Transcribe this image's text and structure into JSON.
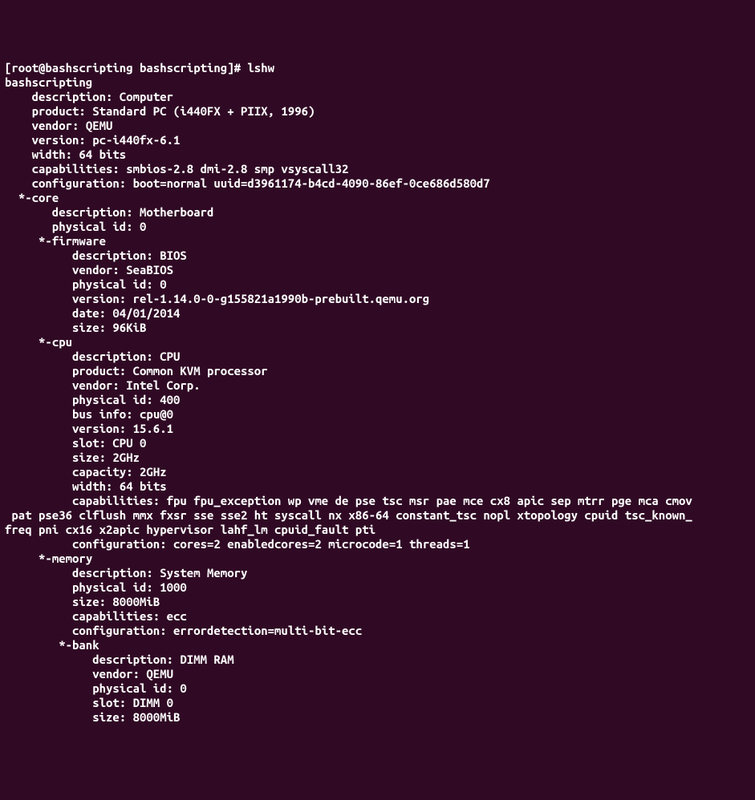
{
  "prompt": "[root@bashscripting bashscripting]# ",
  "command": "lshw",
  "hostname": "bashscripting",
  "root": {
    "description": "Computer",
    "product": "Standard PC (i440FX + PIIX, 1996)",
    "vendor": "QEMU",
    "version": "pc-i440fx-6.1",
    "width": "64 bits",
    "capabilities": "smbios-2.8 dmi-2.8 smp vsyscall32",
    "configuration": "boot=normal uuid=d3961174-b4cd-4090-86ef-0ce686d580d7"
  },
  "core": {
    "header": "*-core",
    "description": "Motherboard",
    "physical_id": "0"
  },
  "firmware": {
    "header": "*-firmware",
    "description": "BIOS",
    "vendor": "SeaBIOS",
    "physical_id": "0",
    "version": "rel-1.14.0-0-g155821a1990b-prebuilt.qemu.org",
    "date": "04/01/2014",
    "size": "96KiB"
  },
  "cpu": {
    "header": "*-cpu",
    "description": "CPU",
    "product": "Common KVM processor",
    "vendor": "Intel Corp.",
    "physical_id": "400",
    "bus_info": "cpu@0",
    "version": "15.6.1",
    "slot": "CPU 0",
    "size": "2GHz",
    "capacity": "2GHz",
    "width": "64 bits",
    "capabilities_l1": "          capabilities: fpu fpu_exception wp vme de pse tsc msr pae mce cx8 apic sep mtrr pge mca cmov",
    "capabilities_l2": " pat pse36 clflush mmx fxsr sse sse2 ht syscall nx x86-64 constant_tsc nopl xtopology cpuid tsc_known_",
    "capabilities_l3": "freq pni cx16 x2apic hypervisor lahf_lm cpuid_fault pti",
    "configuration": "cores=2 enabledcores=2 microcode=1 threads=1"
  },
  "memory": {
    "header": "*-memory",
    "description": "System Memory",
    "physical_id": "1000",
    "size": "8000MiB",
    "capabilities": "ecc",
    "configuration": "errordetection=multi-bit-ecc"
  },
  "bank": {
    "header": "*-bank",
    "description": "DIMM RAM",
    "vendor": "QEMU",
    "physical_id": "0",
    "slot": "DIMM 0",
    "size": "8000MiB"
  }
}
